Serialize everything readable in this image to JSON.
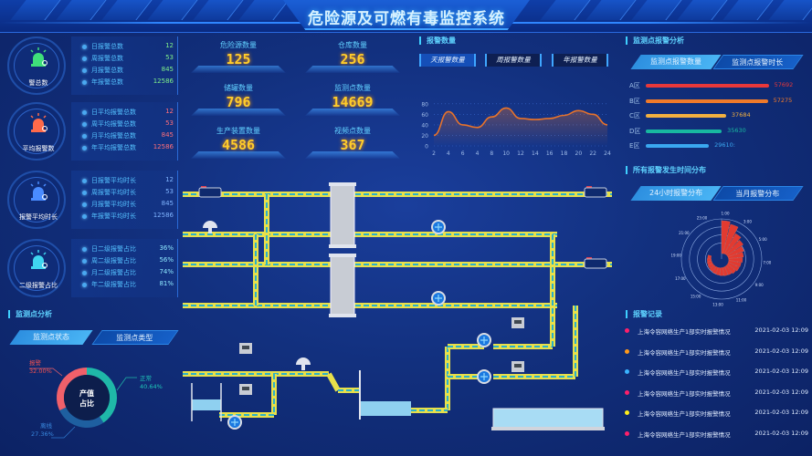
{
  "header": {
    "title": "危险源及可燃有毒监控系统"
  },
  "stat_cards": [
    {
      "label": "警总数",
      "icon": "alarm-light-icon",
      "icon_color": "#3fe07a",
      "value_color": "#7ff08a",
      "rows": [
        {
          "label": "日报警总数",
          "value": "12"
        },
        {
          "label": "周报警总数",
          "value": "53"
        },
        {
          "label": "月报警总数",
          "value": "845"
        },
        {
          "label": "年报警总数",
          "value": "12586"
        }
      ]
    },
    {
      "label": "平均报警数",
      "icon": "alarm-light-icon",
      "icon_color": "#ff6a4a",
      "value_color": "#ff6f7a",
      "rows": [
        {
          "label": "日平均报警总数",
          "value": "12"
        },
        {
          "label": "周平均报警总数",
          "value": "53"
        },
        {
          "label": "月平均报警总数",
          "value": "845"
        },
        {
          "label": "年平均报警总数",
          "value": "12586"
        }
      ]
    },
    {
      "label": "报警平均时长",
      "icon": "alarm-light-icon",
      "icon_color": "#4a8cff",
      "value_color": "#7fb4ff",
      "rows": [
        {
          "label": "日报警平均时长",
          "value": "12"
        },
        {
          "label": "周报警平均时长",
          "value": "53"
        },
        {
          "label": "月报警平均时长",
          "value": "845"
        },
        {
          "label": "年报警平均时长",
          "value": "12586"
        }
      ]
    },
    {
      "label": "二级报警占比",
      "icon": "alarm-light-icon",
      "icon_color": "#3fd6f0",
      "value_color": "#8ee8ff",
      "rows": [
        {
          "label": "日二级报警占比",
          "value": "36%"
        },
        {
          "label": "周二级报警占比",
          "value": "56%"
        },
        {
          "label": "月二级报警占比",
          "value": "74%"
        },
        {
          "label": "年二级报警占比",
          "value": "81%"
        }
      ]
    }
  ],
  "monitor_analysis": {
    "title": "监测点分析",
    "tabs": [
      {
        "label": "监测点状态",
        "active": true
      },
      {
        "label": "监测点类型",
        "active": false
      }
    ],
    "donut": {
      "center_line1": "产值",
      "center_line2": "占比",
      "slices": [
        {
          "name": "正常",
          "percent": 40.64,
          "label": "40.64%",
          "color": "#1fb8a8"
        },
        {
          "name": "离线",
          "percent": 27.36,
          "label": "27.36%",
          "color": "#1e5fa0"
        },
        {
          "name": "报警",
          "percent": 32.0,
          "label": "32.00%",
          "color": "#f0606a"
        }
      ]
    }
  },
  "kpis": [
    {
      "label": "危险源数量",
      "value": "125"
    },
    {
      "label": "仓库数量",
      "value": "256"
    },
    {
      "label": "储罐数量",
      "value": "796"
    },
    {
      "label": "监测点数量",
      "value": "14669"
    },
    {
      "label": "生产装置数量",
      "value": "4586"
    },
    {
      "label": "视频点数量",
      "value": "367"
    }
  ],
  "alarm_count": {
    "title": "报警数量",
    "tabs": [
      {
        "label": "天报警数量",
        "active": true
      },
      {
        "label": "周报警数量",
        "active": false
      },
      {
        "label": "年报警数量",
        "active": false
      }
    ]
  },
  "chart_data": [
    {
      "type": "area",
      "title": "报警数量",
      "x": [
        "2",
        "4",
        "6",
        "4",
        "8",
        "10",
        "12",
        "14",
        "16",
        "18",
        "20",
        "22",
        "24"
      ],
      "values": [
        20,
        65,
        40,
        35,
        55,
        72,
        52,
        50,
        52,
        58,
        67,
        60,
        40
      ],
      "y_ticks": [
        "0",
        "20",
        "40",
        "60",
        "80"
      ],
      "ylim": [
        0,
        90
      ],
      "line_color": "#e8732a",
      "grid": true
    },
    {
      "type": "bar",
      "title": "监测点报警分析",
      "categories": [
        "A区",
        "B区",
        "C区",
        "D区",
        "E区"
      ],
      "values": [
        57692,
        57275,
        37684,
        35630,
        29610
      ],
      "value_labels": [
        "57692",
        "57275",
        "37684",
        "35630",
        "29610:"
      ],
      "colors": [
        "#e8383a",
        "#f07a2a",
        "#f2b040",
        "#18b8a0",
        "#3aa8f0"
      ],
      "xlim": [
        0,
        60000
      ]
    },
    {
      "type": "bar",
      "subtype": "polar",
      "title": "所有报警发生时间分布",
      "angle_labels": [
        "1:00",
        "3:00",
        "5:00",
        "7:00",
        "9:00",
        "11:00",
        "13:00",
        "15:00",
        "17:00",
        "19:00",
        "21:00",
        "23:00"
      ],
      "values": [
        100,
        92,
        70,
        60,
        52,
        46,
        42,
        38,
        36,
        32,
        28,
        26,
        24,
        22,
        20,
        18,
        16,
        14,
        12,
        10
      ],
      "color": "#e23a30"
    }
  ],
  "monitor_alarm": {
    "title": "监测点报警分析",
    "tabs": [
      {
        "label": "监测点报警数量",
        "active": true
      },
      {
        "label": "监测点报警时长",
        "active": false
      }
    ]
  },
  "time_distribution": {
    "title": "所有报警发生时间分布",
    "tabs": [
      {
        "label": "24小时报警分布",
        "active": true
      },
      {
        "label": "当月报警分布",
        "active": false
      }
    ]
  },
  "alarm_records": {
    "title": "报警记录",
    "items": [
      {
        "text": "上海令容网络生产1部实时报警情况",
        "time": "2021-02-03  12:09",
        "color": "#ff1f6a"
      },
      {
        "text": "上海令容网络生产1部实时报警情况",
        "time": "2021-02-03  12:09",
        "color": "#ff9a1a"
      },
      {
        "text": "上海令容网络生产1部实时报警情况",
        "time": "2021-02-03  12:09",
        "color": "#3ab4ff"
      },
      {
        "text": "上海令容网络生产1部实时报警情况",
        "time": "2021-02-03  12:09",
        "color": "#ff1f6a"
      },
      {
        "text": "上海令容网络生产1部实时报警情况",
        "time": "2021-02-03  12:09",
        "color": "#ffee1a"
      },
      {
        "text": "上海令容网络生产1部实时报警情况",
        "time": "2021-02-03  12:09",
        "color": "#ff1f6a"
      }
    ]
  }
}
